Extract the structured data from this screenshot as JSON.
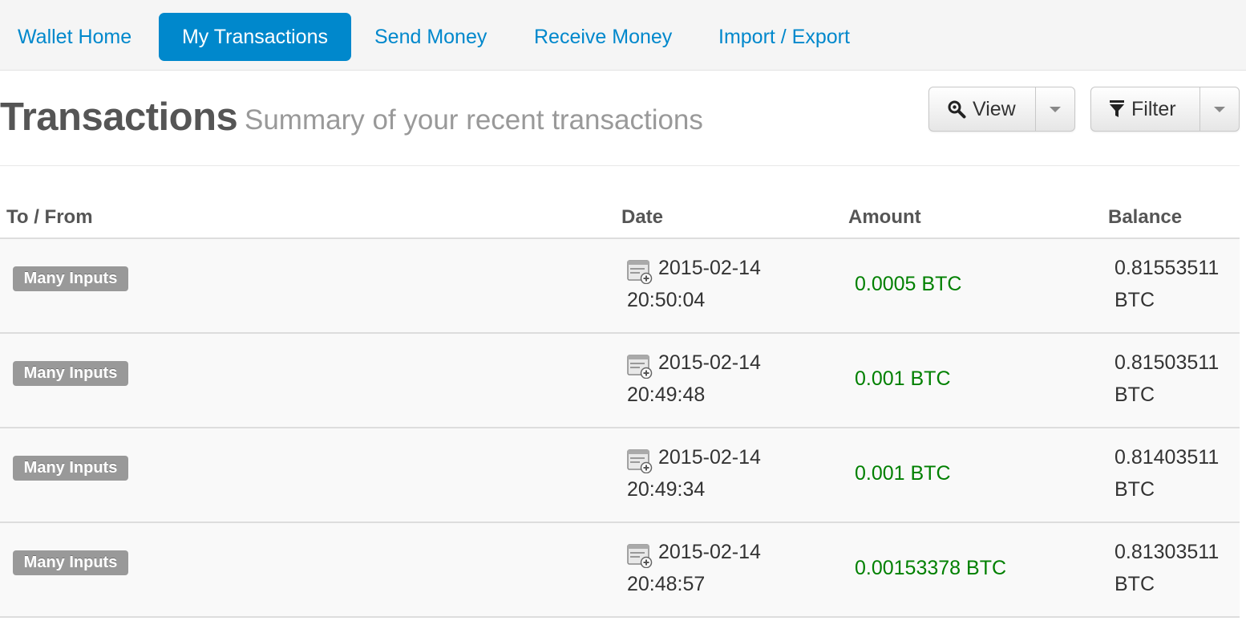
{
  "nav": {
    "tabs": [
      {
        "label": "Wallet Home",
        "active": false
      },
      {
        "label": "My Transactions",
        "active": true
      },
      {
        "label": "Send Money",
        "active": false
      },
      {
        "label": "Receive Money",
        "active": false
      },
      {
        "label": "Import / Export",
        "active": false
      }
    ]
  },
  "header": {
    "title": "Transactions",
    "subtitle": "Summary of your recent transactions"
  },
  "toolbar": {
    "view_label": "View",
    "view_icon": "magnifier-icon",
    "filter_label": "Filter",
    "filter_icon": "funnel-icon",
    "dropdown_icon": "caret-down-icon"
  },
  "table": {
    "columns": [
      "To / From",
      "Date",
      "Amount",
      "Balance"
    ],
    "rows": [
      {
        "to_from": "Many Inputs",
        "date": "2015-02-14",
        "time": "20:50:04",
        "amount": "0.0005 BTC",
        "balance": "0.81553511",
        "balance_unit": "BTC"
      },
      {
        "to_from": "Many Inputs",
        "date": "2015-02-14",
        "time": "20:49:48",
        "amount": "0.001 BTC",
        "balance": "0.81503511",
        "balance_unit": "BTC"
      },
      {
        "to_from": "Many Inputs",
        "date": "2015-02-14",
        "time": "20:49:34",
        "amount": "0.001 BTC",
        "balance": "0.81403511",
        "balance_unit": "BTC"
      },
      {
        "to_from": "Many Inputs",
        "date": "2015-02-14",
        "time": "20:48:57",
        "amount": "0.00153378 BTC",
        "balance": "0.81303511",
        "balance_unit": "BTC"
      }
    ]
  },
  "colors": {
    "accent": "#0088cc",
    "amount_positive": "#008000",
    "badge": "#999999"
  }
}
